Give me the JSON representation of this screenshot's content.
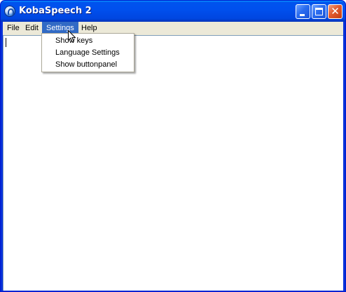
{
  "window": {
    "title": "KobaSpeech 2",
    "controls": {
      "minimize_icon": "minimize-icon",
      "maximize_icon": "maximize-icon",
      "close_glyph": "✕"
    }
  },
  "menubar": {
    "items": [
      {
        "label": "File"
      },
      {
        "label": "Edit"
      },
      {
        "label": "Settings",
        "open": true
      },
      {
        "label": "Help"
      }
    ]
  },
  "settings_menu": {
    "items": [
      {
        "label": "Show keys"
      },
      {
        "label": "Language Settings"
      },
      {
        "label": "Show buttonpanel"
      }
    ]
  },
  "editor": {
    "value": ""
  },
  "colors": {
    "titlebar": "#0050ee",
    "menu_highlight": "#316ac5",
    "close_button": "#e35a2e",
    "window_face": "#ece9d8"
  }
}
